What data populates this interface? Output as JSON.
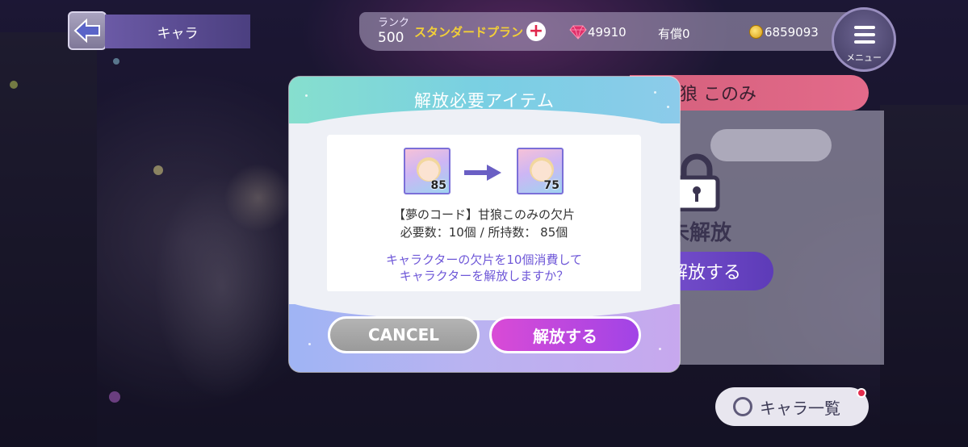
{
  "header": {
    "back_icon": "back-arrow-icon",
    "title": "キャラ",
    "rank_label": "ランク",
    "rank_value": "500",
    "plan_label": "スタンダードプラン",
    "plus_symbol": "+",
    "gem_value": "49910",
    "paid_value": "有償0",
    "coin_value": "6859093",
    "menu_label": "メニュー"
  },
  "side_panel": {
    "character_name": "甘狼 このみ",
    "locked_label": "未解放",
    "unlock_label": "解放する",
    "chara_list_label": "キャラ一覧"
  },
  "modal": {
    "title": "解放必要アイテム",
    "item_before_count": "85",
    "item_after_count": "75",
    "item_name": "【夢のコード】甘狼このみの欠片",
    "requirement": "必要数：10個 / 所持数： 85個",
    "confirm_line1": "キャラクターの欠片を10個消費して",
    "confirm_line2": "キャラクターを解放しますか？",
    "cancel_label": "CANCEL",
    "unlock_label": "解放する"
  },
  "colors": {
    "accent_purple": "#a144e6",
    "header_mint": "#86dfce",
    "confirm_text": "#6f58d8",
    "plan_gold": "#f2cf38",
    "banner_pink": "#e36a8a"
  }
}
